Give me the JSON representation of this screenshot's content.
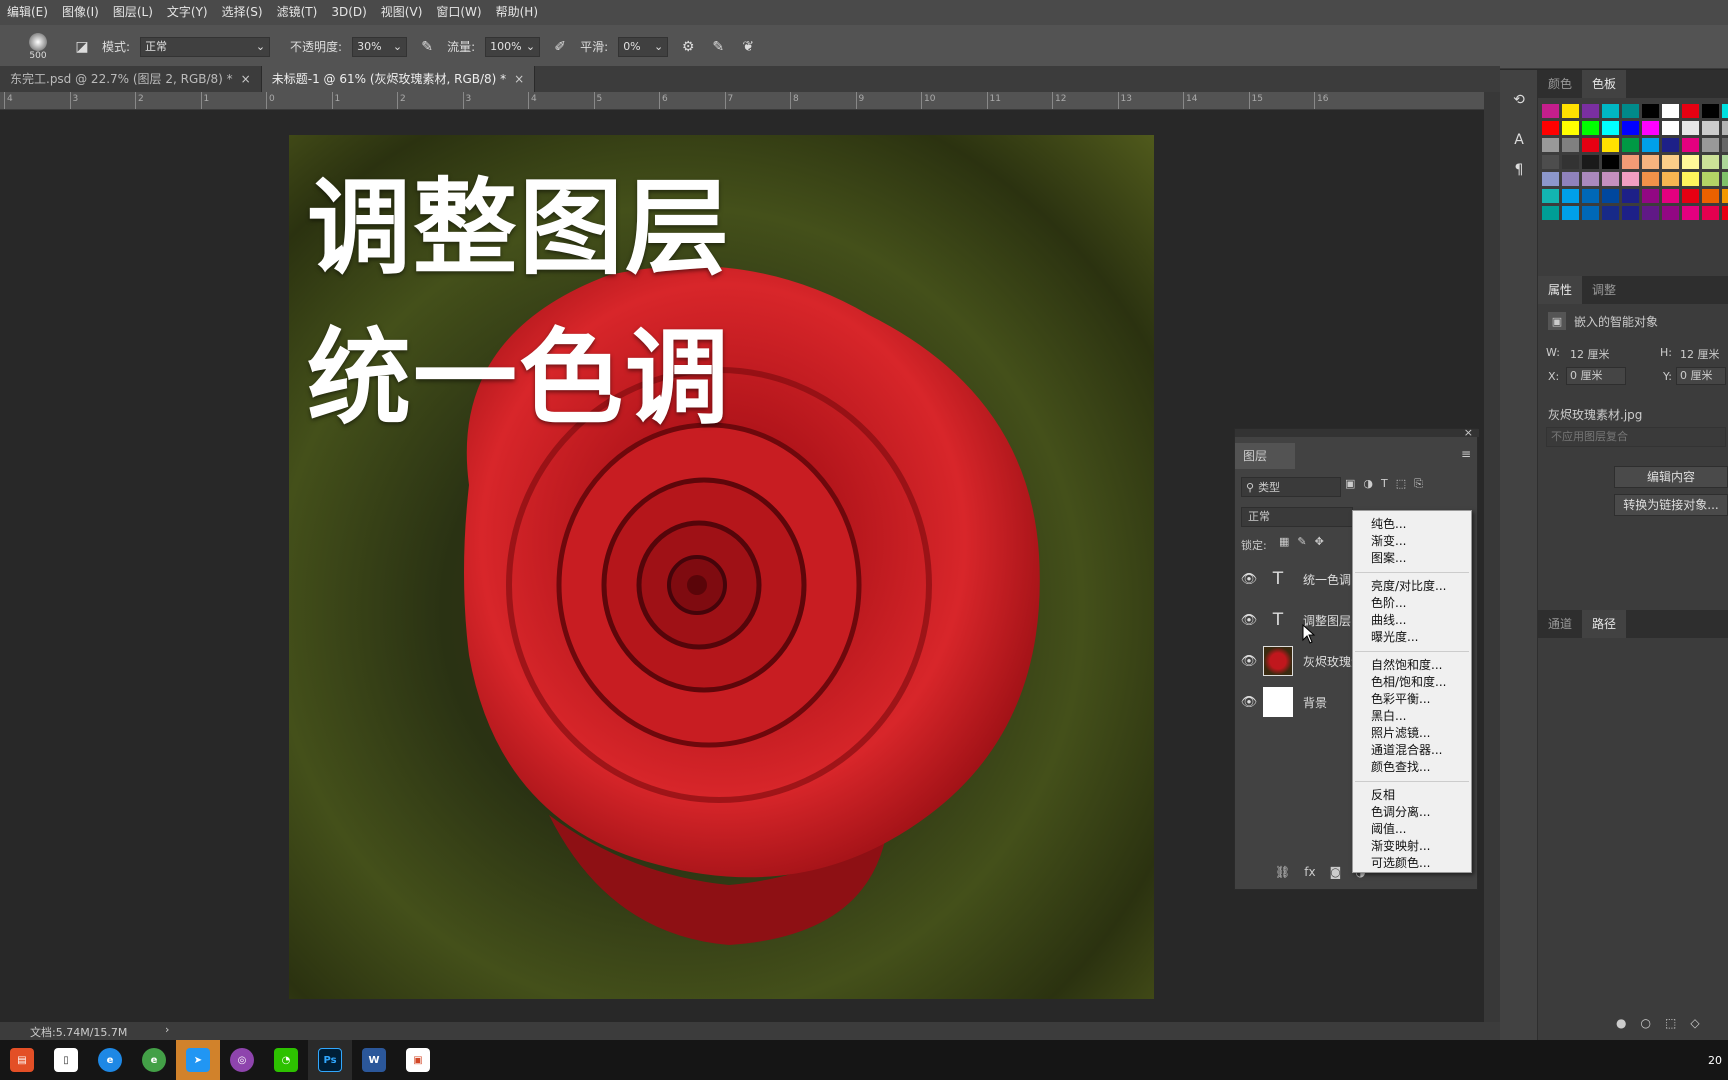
{
  "menu": [
    "编辑(E)",
    "图像(I)",
    "图层(L)",
    "文字(Y)",
    "选择(S)",
    "滤镜(T)",
    "3D(D)",
    "视图(V)",
    "窗口(W)",
    "帮助(H)"
  ],
  "options": {
    "brush_size": "500",
    "mode_label": "模式:",
    "mode_value": "正常",
    "opacity_label": "不透明度:",
    "opacity_value": "30%",
    "flow_label": "流量:",
    "flow_value": "100%",
    "smooth_label": "平滑:",
    "smooth_value": "0%"
  },
  "tabs": [
    {
      "label": "东完工.psd @ 22.7% (图层 2, RGB/8) *",
      "active": false
    },
    {
      "label": "未标题-1 @ 61% (灰烬玫瑰素材, RGB/8) *",
      "active": true
    }
  ],
  "ruler": [
    "4",
    "3",
    "2",
    "1",
    "0",
    "1",
    "2",
    "3",
    "4",
    "5",
    "6",
    "7",
    "8",
    "9",
    "10",
    "11",
    "12",
    "13",
    "14",
    "15",
    "16"
  ],
  "canvas": {
    "line1": "调整图层",
    "line2": "统一色调"
  },
  "status": {
    "doc": "文档:5.74M/15.7M",
    "arrow": "›"
  },
  "swatches_panel": {
    "tab_color": "颜色",
    "tab_swatch": "色板"
  },
  "swatch_colors": [
    "#c41e8c",
    "#ffe100",
    "#7a2fa1",
    "#00b7c3",
    "#008a8a",
    "#000000",
    "#ffffff",
    "#e60012",
    "#000000",
    "#00e0e0",
    "#00a0a0",
    "#ff0000",
    "#ffff00",
    "#00ff00",
    "#00ffff",
    "#0000ff",
    "#ff00ff",
    "#ffffff",
    "#e6e6e6",
    "#cccccc",
    "#b3b3b3",
    "#999999",
    "#999999",
    "#808080",
    "#e60012",
    "#ffe100",
    "#009944",
    "#00a0e9",
    "#1d2088",
    "#e4007f",
    "#999999",
    "#666666",
    "#808080",
    "#4d4d4d",
    "#333333",
    "#1a1a1a",
    "#000000",
    "#f29b76",
    "#f6b37f",
    "#facd89",
    "#fff799",
    "#cce198",
    "#acd598",
    "#89c997",
    "#8c97cb",
    "#8f82bc",
    "#aa89bd",
    "#c490bf",
    "#f19ec2",
    "#f19149",
    "#f8b551",
    "#fff45c",
    "#b3d465",
    "#80c269",
    "#32b16c",
    "#13b5b1",
    "#00a0e9",
    "#0068b7",
    "#00479d",
    "#1d2088",
    "#920783",
    "#e4007f",
    "#e60012",
    "#eb6100",
    "#f39800",
    "#009944",
    "#009e96",
    "#00a0e9",
    "#0068b7",
    "#172a88",
    "#1d2088",
    "#601986",
    "#920783",
    "#e4007f",
    "#e5004f",
    "#e60012"
  ],
  "properties": {
    "tab_props": "属性",
    "tab_adjust": "调整",
    "type": "嵌入的智能对象",
    "w_label": "W:",
    "w_value": "12 厘米",
    "h_label": "H:",
    "h_value": "12 厘米",
    "x_label": "X:",
    "x_value": "0 厘米",
    "y_label": "Y:",
    "y_value": "0 厘米",
    "filename": "灰烬玫瑰素材.jpg",
    "comp": "不应用图层复合",
    "edit_btn": "编辑内容",
    "convert_btn": "转换为链接对象..."
  },
  "paths": {
    "tab_channels": "通道",
    "tab_paths": "路径"
  },
  "layers": {
    "title": "图层",
    "filter": "类型",
    "blend": "正常",
    "lock_label": "锁定:",
    "items": [
      {
        "name": "统一色调",
        "type": "text"
      },
      {
        "name": "调整图层",
        "type": "text"
      },
      {
        "name": "灰烬玫瑰素材",
        "type": "image"
      },
      {
        "name": "背景",
        "type": "bg"
      }
    ]
  },
  "dropdown": [
    [
      "纯色...",
      "渐变...",
      "图案..."
    ],
    [
      "亮度/对比度...",
      "色阶...",
      "曲线...",
      "曝光度..."
    ],
    [
      "自然饱和度...",
      "色相/饱和度...",
      "色彩平衡...",
      "黑白...",
      "照片滤镜...",
      "通道混合器...",
      "颜色查找..."
    ],
    [
      "反相",
      "色调分离...",
      "阈值...",
      "渐变映射...",
      "可选颜色..."
    ]
  ],
  "taskbar": {
    "ps_label": "Ps",
    "clock": "20"
  }
}
